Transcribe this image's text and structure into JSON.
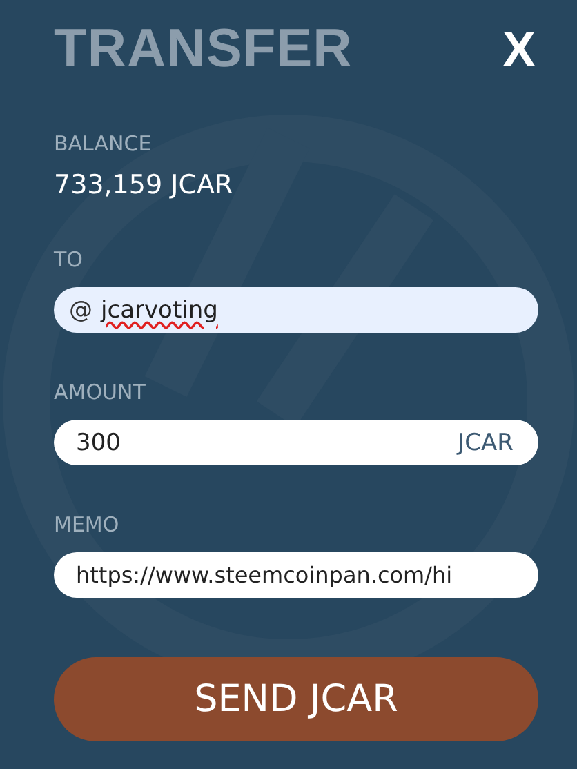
{
  "title": "TRANSFER",
  "close": "X",
  "balance": {
    "label": "BALANCE",
    "value": "733,159 JCAR"
  },
  "to": {
    "label": "TO",
    "prefix": "@",
    "value": "jcarvoting",
    "misspelled": true,
    "autofilled": true
  },
  "amount": {
    "label": "AMOUNT",
    "value": "300",
    "suffix": "JCAR"
  },
  "memo": {
    "label": "MEMO",
    "value": "https://www.steemcoinpan.com/hi"
  },
  "submit": "SEND JCAR"
}
